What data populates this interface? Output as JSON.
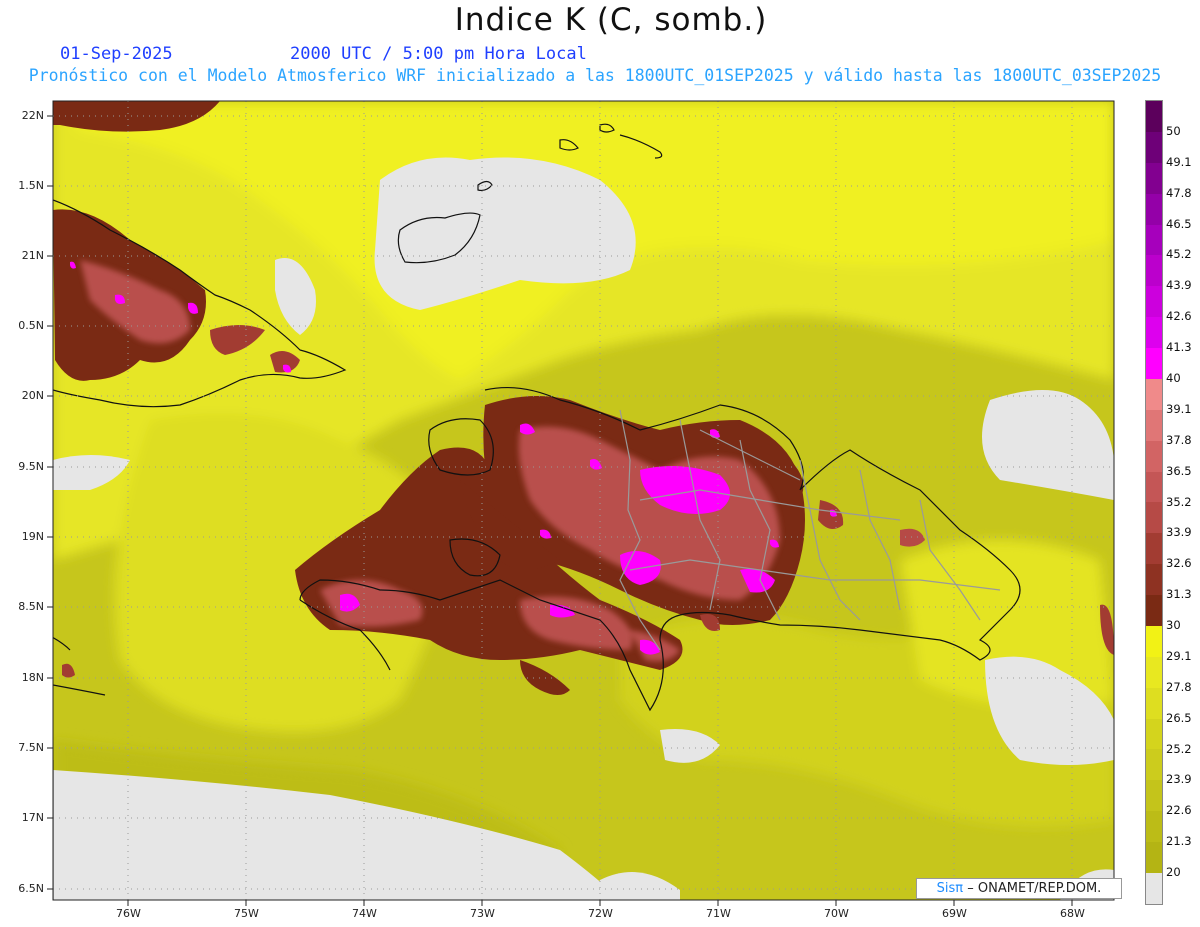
{
  "header": {
    "title": "Indice K (C, somb.)",
    "date": "01-Sep-2025",
    "time": "2000 UTC / 5:00 pm Hora Local",
    "subtitle": "Pronóstico con el Modelo Atmosferico WRF inicializado a las 1800UTC_01SEP2025 y válido hasta las  1800UTC_03SEP2025"
  },
  "map": {
    "lat_labels": [
      "22N",
      "1.5N",
      "21N",
      "0.5N",
      "20N",
      "9.5N",
      "19N",
      "8.5N",
      "18N",
      "7.5N",
      "17N",
      "6.5N"
    ],
    "lon_labels": [
      "76W",
      "75W",
      "74W",
      "73W",
      "72W",
      "71W",
      "70W",
      "69W",
      "68W"
    ],
    "lat_range": [
      16.5,
      22.0
    ],
    "lon_range": [
      -76.65,
      -67.6
    ],
    "grid": "dotted"
  },
  "colorbar": {
    "levels": [
      "50",
      "49.1",
      "47.8",
      "46.5",
      "45.2",
      "43.9",
      "42.6",
      "41.3",
      "40",
      "39.1",
      "37.8",
      "36.5",
      "35.2",
      "33.9",
      "32.6",
      "31.3",
      "30",
      "29.1",
      "27.8",
      "26.5",
      "25.2",
      "23.9",
      "22.6",
      "21.3",
      "20"
    ],
    "colors": [
      "#5c005c",
      "#6e0078",
      "#820090",
      "#9400a8",
      "#a600bc",
      "#bb00cc",
      "#cc00dd",
      "#dd00ee",
      "#ff00ff",
      "#f08a8a",
      "#e07676",
      "#d26464",
      "#c45656",
      "#b64a46",
      "#a23c32",
      "#8e3222",
      "#7a2a14",
      "#f2f215",
      "#e8e820",
      "#dede20",
      "#d4d41d",
      "#cccc1d",
      "#c4c41b",
      "#bcbc17",
      "#b4b414",
      "#e6e6e6"
    ]
  },
  "credit": {
    "logo": "Sisπ",
    "text": "– ONAMET/REP.DOM."
  }
}
